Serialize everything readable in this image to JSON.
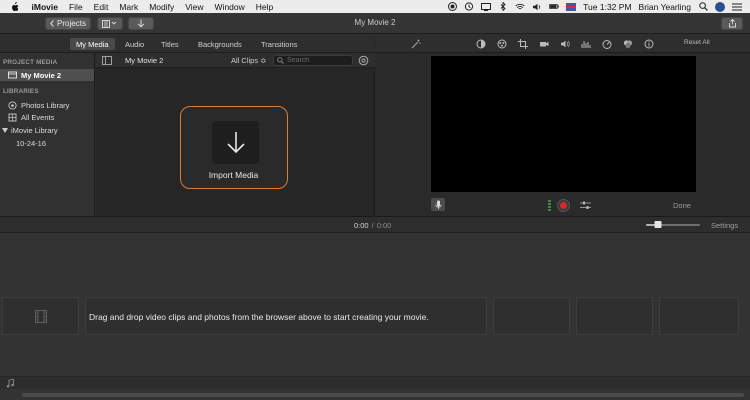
{
  "menubar": {
    "app_name": "iMovie",
    "items": [
      "File",
      "Edit",
      "Mark",
      "Modify",
      "View",
      "Window",
      "Help"
    ],
    "clock": "Tue 1:32 PM",
    "user": "Brian Yearling"
  },
  "toolbar": {
    "projects_label": "Projects",
    "window_title": "My Movie 2"
  },
  "browser_tabs": [
    "My Media",
    "Audio",
    "Titles",
    "Backgrounds",
    "Transitions"
  ],
  "active_tab": "My Media",
  "viewer_tools": {
    "reset_label": "Reset All"
  },
  "sidebar": {
    "project_heading": "PROJECT MEDIA",
    "project_item": "My Movie 2",
    "libraries_heading": "LIBRARIES",
    "library_items": [
      "Photos Library",
      "All Events"
    ],
    "imovie_library": "iMovie Library",
    "event_item": "10-24-16"
  },
  "browser": {
    "title": "My Movie 2",
    "filter": "All Clips ≎",
    "search_placeholder": "Search",
    "import_label": "Import Media"
  },
  "viewer": {
    "done_label": "Done"
  },
  "timeline": {
    "current_time": "0:00",
    "separator": "/",
    "duration": "0:00",
    "settings_label": "Settings",
    "zoom_level": 0.23,
    "drop_message": "Drag and drop video clips and photos from the browser above to start creating your movie."
  },
  "colors": {
    "accent_orange": "#e07a2e",
    "record_red": "#d62a2a",
    "panel_bg": "#2b2b2b"
  }
}
